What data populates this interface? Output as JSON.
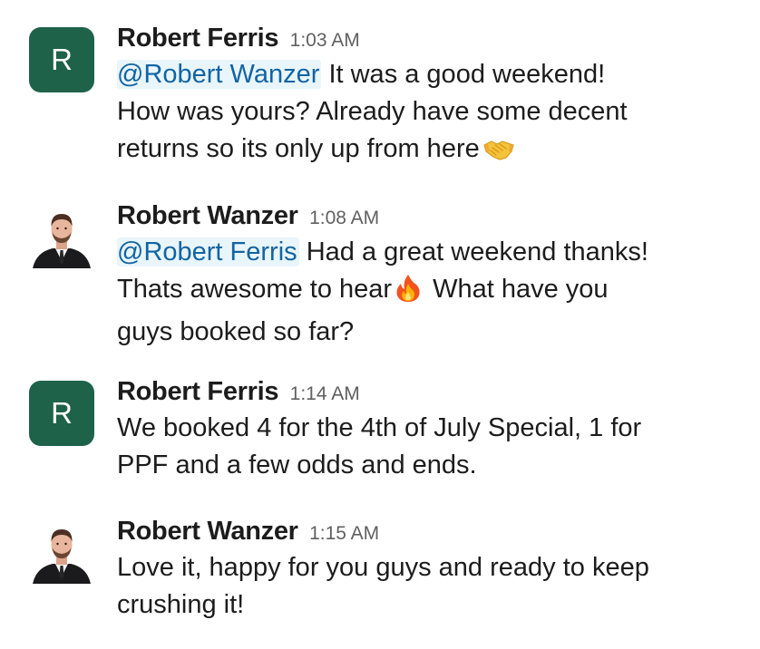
{
  "messages": [
    {
      "sender": "Robert Ferris",
      "avatar_letter": "R",
      "time": "1:03 AM",
      "mention": "@Robert Wanzer",
      "text_line1": " It was a good weekend!",
      "text_line2": "How was yours? Already have some decent",
      "text_line3": "returns so its only up from here",
      "emoji": "handshake-emoji"
    },
    {
      "sender": "Robert Wanzer",
      "time": "1:08 AM",
      "mention": "@Robert Ferris",
      "text_line1": " Had a great weekend thanks!",
      "text_line2a": "Thats awesome to hear",
      "text_line2b": " What have you",
      "text_line3": "guys booked so far?",
      "emoji": "fire-emoji"
    },
    {
      "sender": "Robert Ferris",
      "avatar_letter": "R",
      "time": "1:14 AM",
      "text_line1": "We booked 4 for the 4th of July Special, 1 for",
      "text_line2": "PPF and a few odds and ends."
    },
    {
      "sender": "Robert Wanzer",
      "time": "1:15 AM",
      "text_line1": "Love it, happy for you guys and ready to keep",
      "text_line2": "crushing it!"
    }
  ],
  "colors": {
    "avatar_bg": "#1e6249",
    "mention_bg": "#e8f5fa",
    "mention_text": "#1264a3",
    "timestamp": "#616061"
  }
}
